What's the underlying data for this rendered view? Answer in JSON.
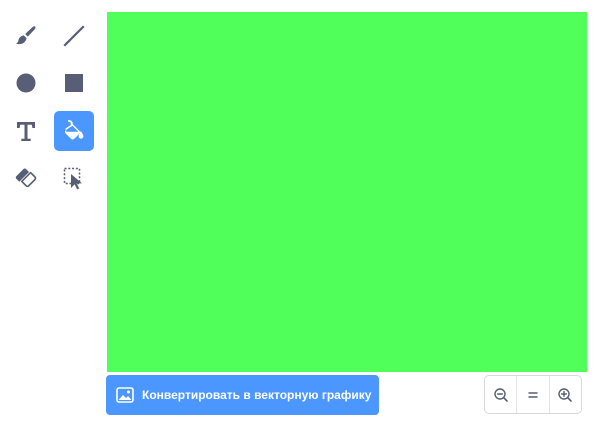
{
  "tools": [
    {
      "id": "brush",
      "icon": "brush-icon",
      "active": false
    },
    {
      "id": "line",
      "icon": "line-icon",
      "active": false
    },
    {
      "id": "circle",
      "icon": "circle-icon",
      "active": false
    },
    {
      "id": "rectangle",
      "icon": "rectangle-icon",
      "active": false
    },
    {
      "id": "text",
      "icon": "text-icon",
      "active": false
    },
    {
      "id": "fill",
      "icon": "fill-bucket-icon",
      "active": true
    },
    {
      "id": "eraser",
      "icon": "eraser-icon",
      "active": false
    },
    {
      "id": "select",
      "icon": "select-icon",
      "active": false
    }
  ],
  "canvas": {
    "fill_color": "#50ff5a"
  },
  "convert_button": {
    "label": "Конвертировать в векторную графику",
    "icon": "image-icon"
  },
  "zoom": {
    "zoom_out_icon": "zoom-out-icon",
    "reset_icon": "zoom-reset-icon",
    "zoom_in_icon": "zoom-in-icon"
  },
  "colors": {
    "accent": "#4c97ff",
    "icon": "#575e75",
    "canvas": "#50ff5a"
  }
}
